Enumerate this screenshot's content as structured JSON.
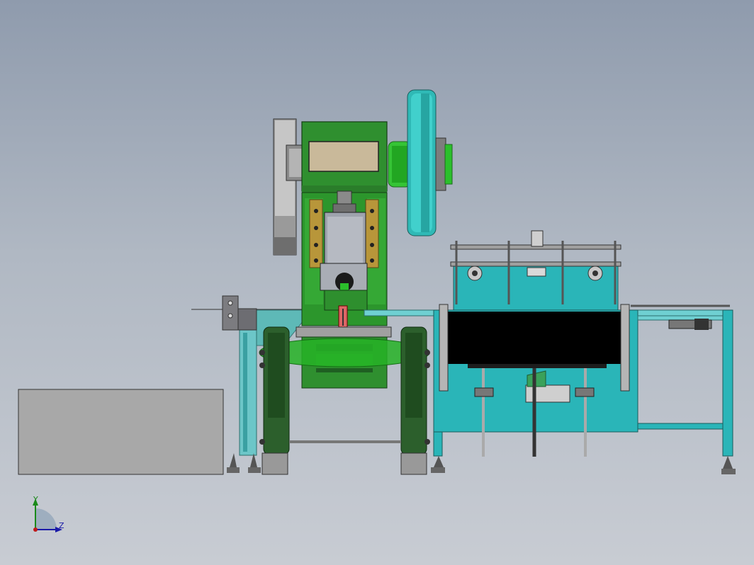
{
  "triad": {
    "y_label": "Y",
    "z_label": "Z"
  },
  "colors": {
    "background_top": "#8f9bad",
    "background_bottom": "#c8ccd3",
    "press_green": "#2f8f2f",
    "press_dark_green": "#1f5f22",
    "flywheel_cyan": "#2ab8b4",
    "conveyor_cyan": "#2ab5b8",
    "conveyor_belt": "#000000",
    "gray_box": "#a8a8a8",
    "brass": "#b8963a"
  }
}
